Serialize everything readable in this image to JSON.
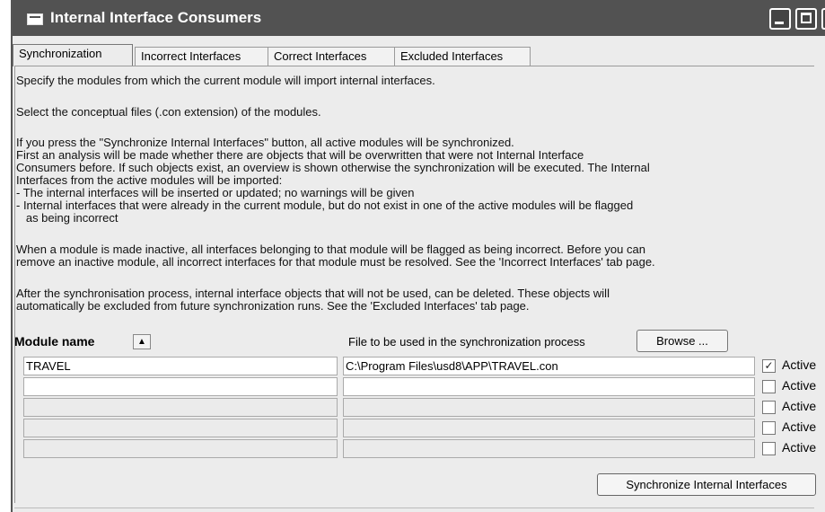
{
  "window": {
    "title": "Internal Interface Consumers"
  },
  "tabs": [
    {
      "label": "Synchronization",
      "active": true
    },
    {
      "label": "Incorrect Interfaces",
      "active": false
    },
    {
      "label": "Correct Interfaces",
      "active": false
    },
    {
      "label": "Excluded Interfaces",
      "active": false
    }
  ],
  "description": {
    "p1": "Specify the modules from which the current module will import internal interfaces.",
    "p2": "Select the conceptual files (.con extension) of the modules.",
    "p3": [
      "If you press the \"Synchronize Internal Interfaces\" button, all active modules will be synchronized.",
      "First an analysis will be made whether there are objects that will be overwritten that were not Internal Interface",
      "Consumers before. If such objects exist, an overview is shown otherwise the synchronization will be executed. The Internal",
      "Interfaces from the active modules will be imported:",
      "- The internal interfaces will be inserted or updated; no warnings will be given",
      "- Internal interfaces that were already in the current module, but do not exist in one of the active modules will be flagged",
      "   as being incorrect"
    ],
    "p4": [
      "When a module is made inactive, all interfaces belonging to that module will be flagged as being incorrect. Before you can",
      "remove an inactive module, all incorrect interfaces for that module must be resolved. See the 'Incorrect Interfaces' tab page."
    ],
    "p5": [
      "After the synchronisation process, internal interface objects that will not be used, can be deleted. These objects will",
      "automatically be excluded from future synchronization runs. See the 'Excluded Interfaces' tab page."
    ]
  },
  "grid": {
    "module_header": "Module name",
    "sort_icon": "sort-ascending-icon",
    "file_header": "File to be used in the synchronization process",
    "browse_label": "Browse ...",
    "active_label": "Active",
    "rows": [
      {
        "module": "TRAVEL",
        "file": "C:\\Program Files\\usd8\\APP\\TRAVEL.con",
        "active": true
      },
      {
        "module": "",
        "file": "",
        "active": false
      },
      {
        "module": "",
        "file": "",
        "active": false
      },
      {
        "module": "",
        "file": "",
        "active": false
      },
      {
        "module": "",
        "file": "",
        "active": false
      }
    ]
  },
  "sync_button_label": "Synchronize Internal Interfaces",
  "colors": {
    "titlebar": "#525252",
    "window_bg": "#ececec"
  }
}
